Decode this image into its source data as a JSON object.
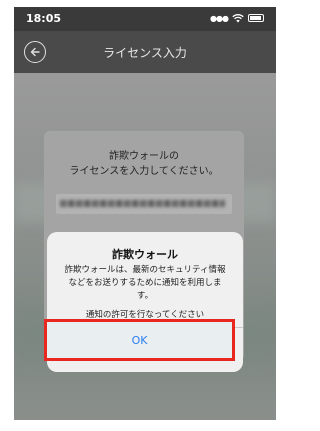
{
  "status_bar": {
    "time": "18:05",
    "signal_icon": "signal-dots-icon",
    "wifi_icon": "wifi-icon",
    "battery_icon": "battery-icon"
  },
  "nav_bar": {
    "back_icon": "back-arrow-icon",
    "title": "ライセンス入力"
  },
  "license_card": {
    "message": "詐欺ウォールの\nライセンスを入力してください。"
  },
  "alert": {
    "title": "詐欺ウォール",
    "body": "詐欺ウォールは、最新のセキュリティ情報\nなどをお送りするために通知を利用しま\nす。",
    "note": "通知の許可を行なってください",
    "ok_label": "OK"
  },
  "colors": {
    "status_bar_bg": "#3a3a3a",
    "nav_bar_bg": "#4a4a4a",
    "alert_bg": "#f0f0f0",
    "ok_text": "#2b7cf0",
    "highlight_border": "#e8281e"
  }
}
